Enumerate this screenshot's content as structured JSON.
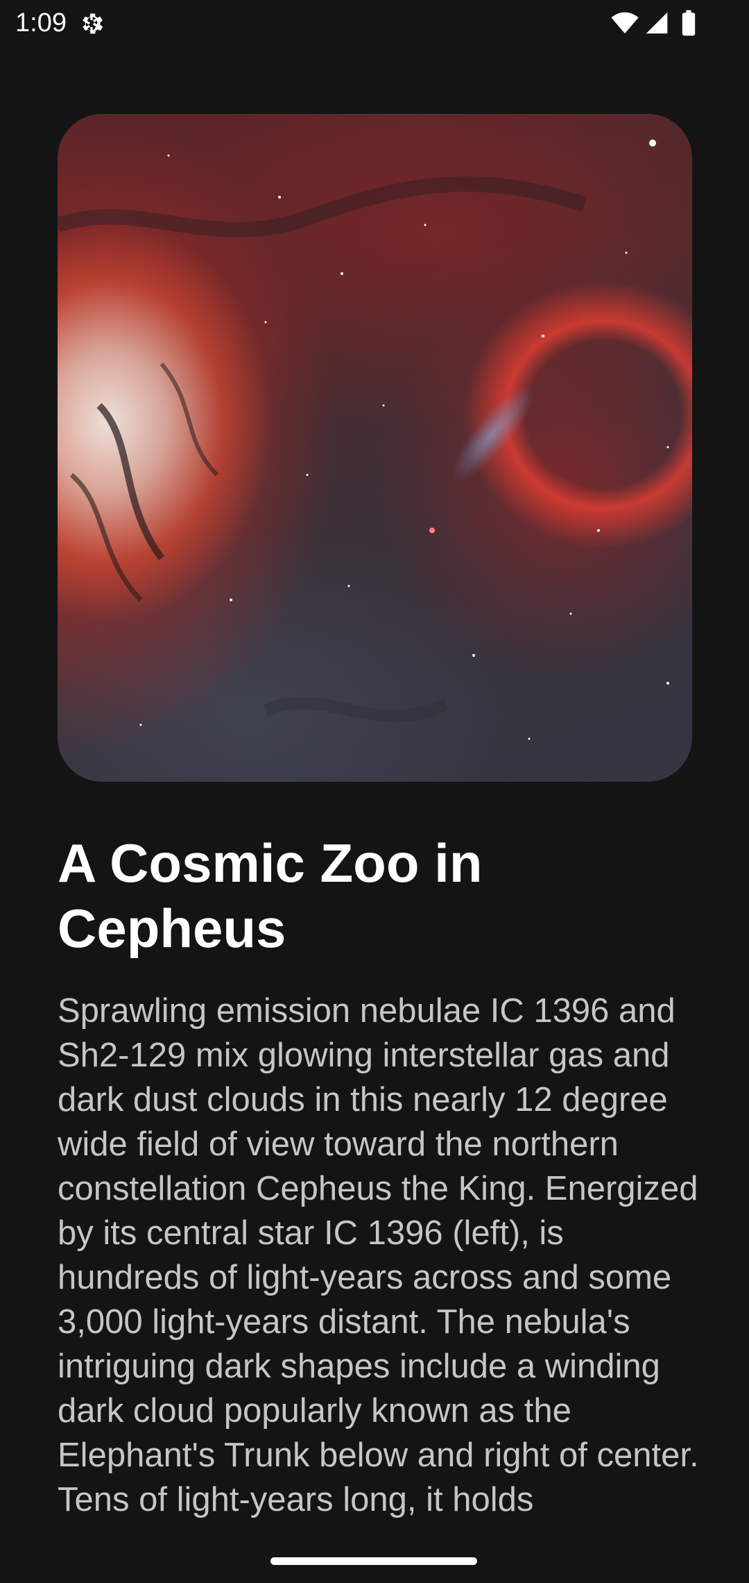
{
  "status_bar": {
    "time": "1:09",
    "icons": [
      "settings-icon",
      "wifi-icon",
      "signal-icon",
      "battery-icon"
    ]
  },
  "hero_image": {
    "description_icon": "nebula-photo",
    "colors": {
      "nebula_red": "#d83a30",
      "core_white": "#ece4df",
      "dust_dark": "#2a1e22",
      "background": "#141414"
    }
  },
  "article": {
    "title": "A Cosmic Zoo in Cepheus",
    "body": "Sprawling emission nebulae IC 1396 and Sh2-129 mix glowing interstellar gas and dark dust clouds in this nearly 12 degree wide field of view toward the northern constellation Cepheus the King. Energized by its central star IC 1396 (left), is hundreds of light-years across and some 3,000 light-years distant. The nebula's intriguing dark shapes include a winding dark cloud popularly known as the Elephant's Trunk below and right of center. Tens of light-years long, it holds"
  }
}
